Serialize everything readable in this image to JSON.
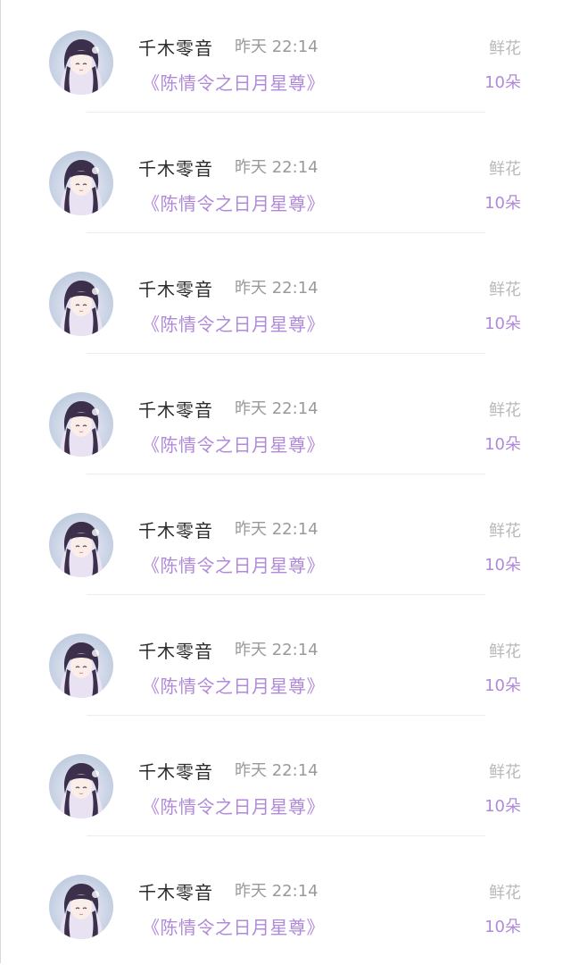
{
  "colors": {
    "accent_purple": "#b08ad9",
    "name_text": "#2b2b2b",
    "muted_text": "#9a9a9a",
    "gift_label": "#b9b9b9",
    "divider": "#ececec"
  },
  "rows": [
    {
      "name": "千木零音",
      "time": "昨天 22:14",
      "title": "《陈情令之日月星尊》",
      "gift_label": "鲜花",
      "gift_count": "10朵",
      "avatar_icon": "avatar-anime-girl"
    },
    {
      "name": "千木零音",
      "time": "昨天 22:14",
      "title": "《陈情令之日月星尊》",
      "gift_label": "鲜花",
      "gift_count": "10朵",
      "avatar_icon": "avatar-anime-girl"
    },
    {
      "name": "千木零音",
      "time": "昨天 22:14",
      "title": "《陈情令之日月星尊》",
      "gift_label": "鲜花",
      "gift_count": "10朵",
      "avatar_icon": "avatar-anime-girl"
    },
    {
      "name": "千木零音",
      "time": "昨天 22:14",
      "title": "《陈情令之日月星尊》",
      "gift_label": "鲜花",
      "gift_count": "10朵",
      "avatar_icon": "avatar-anime-girl"
    },
    {
      "name": "千木零音",
      "time": "昨天 22:14",
      "title": "《陈情令之日月星尊》",
      "gift_label": "鲜花",
      "gift_count": "10朵",
      "avatar_icon": "avatar-anime-girl"
    },
    {
      "name": "千木零音",
      "time": "昨天 22:14",
      "title": "《陈情令之日月星尊》",
      "gift_label": "鲜花",
      "gift_count": "10朵",
      "avatar_icon": "avatar-anime-girl"
    },
    {
      "name": "千木零音",
      "time": "昨天 22:14",
      "title": "《陈情令之日月星尊》",
      "gift_label": "鲜花",
      "gift_count": "10朵",
      "avatar_icon": "avatar-anime-girl"
    },
    {
      "name": "千木零音",
      "time": "昨天 22:14",
      "title": "《陈情令之日月星尊》",
      "gift_label": "鲜花",
      "gift_count": "10朵",
      "avatar_icon": "avatar-anime-girl"
    }
  ]
}
